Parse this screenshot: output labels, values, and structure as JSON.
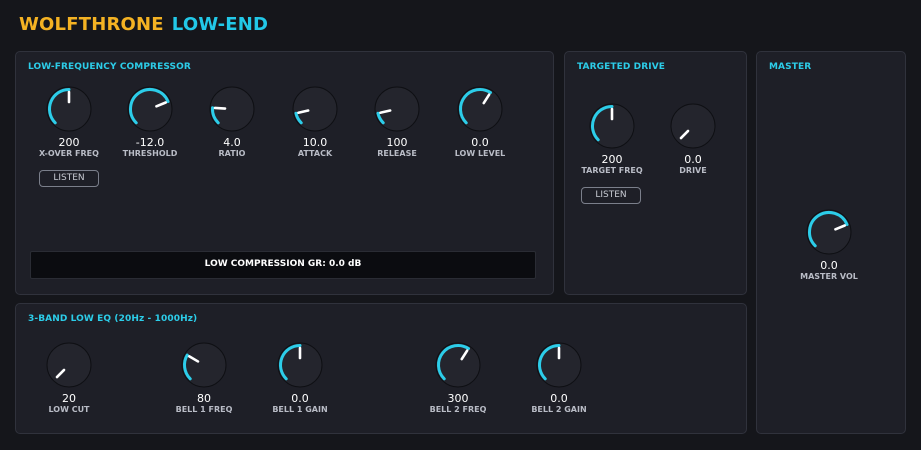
{
  "header": {
    "brand": "WOLFTHRONE",
    "product": "LOW-END"
  },
  "accent": "#2ccde9",
  "brand_color": "#f4b223",
  "compressor": {
    "title": "LOW-FREQUENCY COMPRESSOR",
    "knobs": [
      {
        "value": "200",
        "label": "X-OVER FREQ",
        "level": 0.5
      },
      {
        "value": "-12.0",
        "label": "THRESHOLD",
        "level": 0.75
      },
      {
        "value": "4.0",
        "label": "RATIO",
        "level": 0.18
      },
      {
        "value": "10.0",
        "label": "ATTACK",
        "level": 0.12
      },
      {
        "value": "100",
        "label": "RELEASE",
        "level": 0.12
      },
      {
        "value": "0.0",
        "label": "LOW LEVEL",
        "level": 0.62
      }
    ],
    "listen_label": "LISTEN",
    "gr_text": "LOW COMPRESSION GR: 0.0 dB"
  },
  "drive": {
    "title": "TARGETED DRIVE",
    "knobs": [
      {
        "value": "200",
        "label": "TARGET FREQ",
        "level": 0.5
      },
      {
        "value": "0.0",
        "label": "DRIVE",
        "level": 0.0
      }
    ],
    "listen_label": "LISTEN"
  },
  "master": {
    "title": "MASTER",
    "knobs": [
      {
        "value": "0.0",
        "label": "MASTER VOL",
        "level": 0.75
      }
    ]
  },
  "eq": {
    "title": "3-BAND LOW EQ (20Hz - 1000Hz)",
    "knobs": [
      {
        "value": "20",
        "label": "LOW CUT",
        "level": 0.0
      },
      {
        "value": "80",
        "label": "BELL 1 FREQ",
        "level": 0.28
      },
      {
        "value": "0.0",
        "label": "BELL 1 GAIN",
        "level": 0.5
      },
      {
        "value": "300",
        "label": "BELL 2 FREQ",
        "level": 0.62
      },
      {
        "value": "0.0",
        "label": "BELL 2 GAIN",
        "level": 0.5
      }
    ]
  }
}
